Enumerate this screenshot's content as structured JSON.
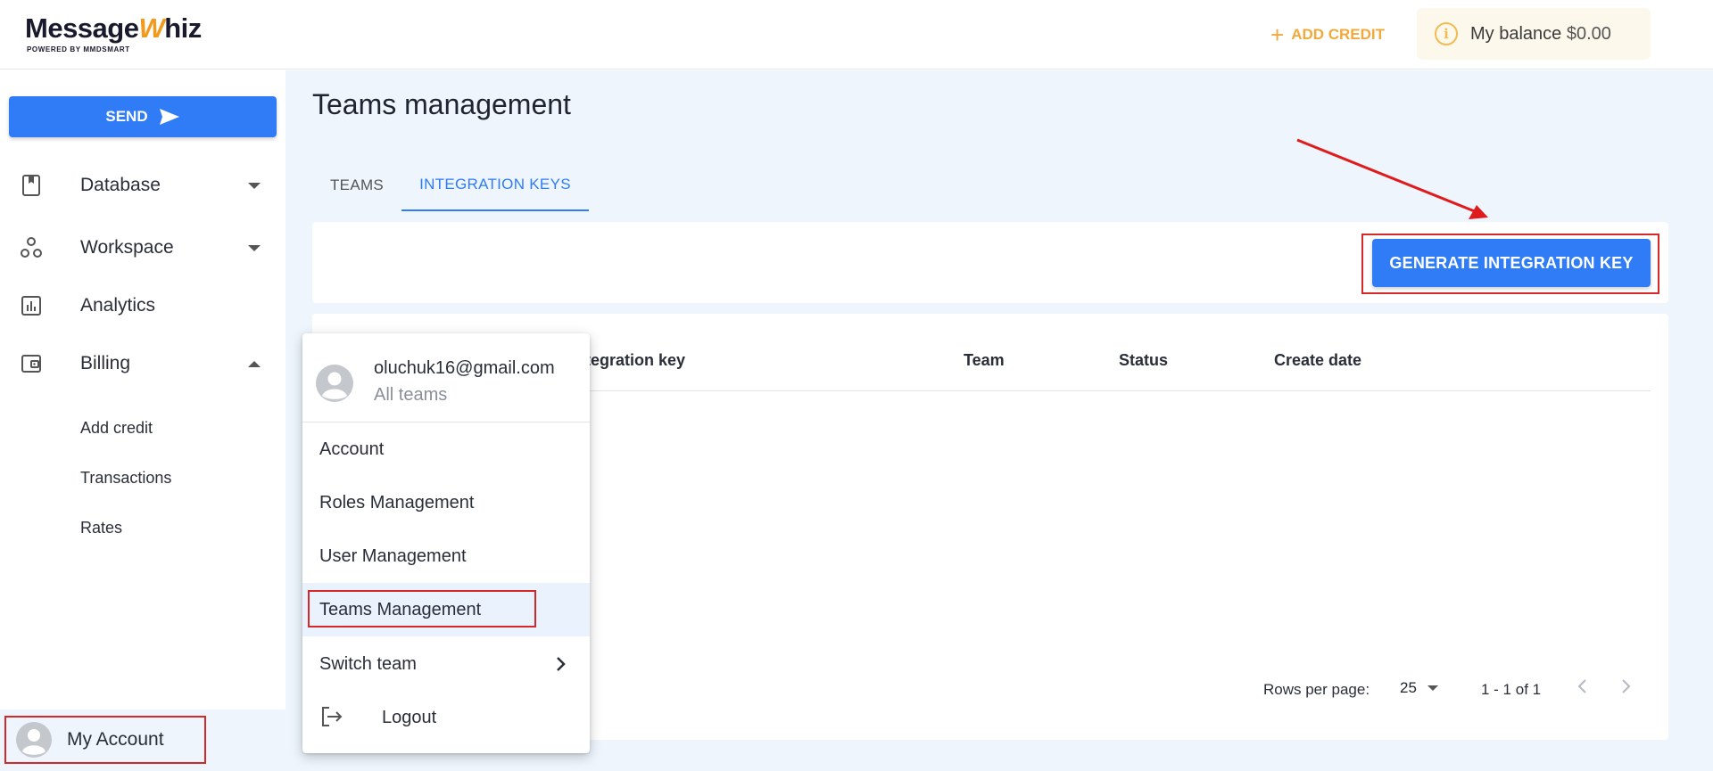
{
  "brand": {
    "name_part1": "Message",
    "name_w": "W",
    "name_part2": "hiz",
    "tagline": "POWERED BY MMDSMART"
  },
  "header": {
    "add_credit_label": "ADD CREDIT",
    "balance_label": "My balance",
    "balance_value": "$0.00"
  },
  "sidebar": {
    "send_label": "SEND",
    "items": [
      {
        "label": "Database",
        "icon": "bookmark-icon",
        "expanded": false
      },
      {
        "label": "Workspace",
        "icon": "workspace-icon",
        "expanded": false
      },
      {
        "label": "Analytics",
        "icon": "analytics-icon"
      },
      {
        "label": "Billing",
        "icon": "wallet-icon",
        "expanded": true
      }
    ],
    "billing_sub": [
      "Add credit",
      "Transactions",
      "Rates"
    ],
    "account_label": "My Account"
  },
  "main": {
    "title": "Teams management",
    "tabs": [
      {
        "label": "TEAMS",
        "active": false
      },
      {
        "label": "INTEGRATION KEYS",
        "active": true
      }
    ],
    "generate_button": "GENERATE INTEGRATION KEY",
    "table": {
      "columns": [
        "Integration key",
        "Team",
        "Status",
        "Create date"
      ],
      "rows": []
    },
    "pagination": {
      "rows_per_page_label": "Rows per page:",
      "rows_per_page_value": "25",
      "range": "1 - 1 of 1"
    }
  },
  "account_menu": {
    "email": "oluchuk16@gmail.com",
    "team": "All teams",
    "items": [
      "Account",
      "Roles Management",
      "User Management",
      "Teams Management"
    ],
    "selected": "Teams Management",
    "switch_team": "Switch team",
    "logout": "Logout"
  },
  "colors": {
    "primary": "#2f7cf6",
    "accent": "#f2a93b",
    "highlight": "#d62828",
    "page_bg": "#eef5fd"
  }
}
